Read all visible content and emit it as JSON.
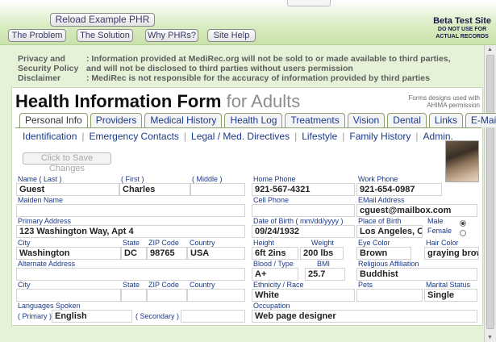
{
  "header": {
    "reload_label": "Reload  Example  PHR",
    "buttons": [
      "The Problem",
      "The Solution",
      "Why PHRs?",
      "Site Help"
    ],
    "beta_title": "Beta Test Site",
    "beta_line1": "DO NOT USE FOR",
    "beta_line2": "ACTUAL RECORDS"
  },
  "notices": [
    {
      "key": "Privacy and",
      "text": ": Information provided at MediRec.org will not be sold to or made available to third parties,"
    },
    {
      "key": "Security Policy",
      "text": "and will not be disclosed to third parties without users permission"
    },
    {
      "key": "Disclaimer",
      "text": ": MediRec is not responsible for the accuracy of information provided by third parties"
    }
  ],
  "form": {
    "title": "Health Information Form",
    "subtitle": "for Adults",
    "note_line1": "Forms designs used with",
    "note_line2": "AHIMA permission",
    "tabs": [
      "Personal Info",
      "Providers",
      "Medical History",
      "Health Log",
      "Treatments",
      "Vision",
      "Dental",
      "Links",
      "E-Mail"
    ],
    "active_tab": "Personal Info",
    "subnav": [
      "Identification",
      "Emergency Contacts",
      "Legal / Med. Directives",
      "Lifestyle",
      "Family History",
      "Admin."
    ],
    "save_label": "Click to Save Changes"
  },
  "labels": {
    "name_last": "Name ( Last )",
    "first": "( First )",
    "middle": "( Middle )",
    "home_phone": "Home Phone",
    "work_phone": "Work Phone",
    "maiden_name": "Maiden Name",
    "cell_phone": "Cell Phone",
    "email": "EMail Address",
    "primary_address": "Primary Address",
    "dob": "Date of Birth  ( mm/dd/yyyy )",
    "place_of_birth": "Place of Birth",
    "male": "Male",
    "female": "Female",
    "city": "City",
    "state": "State",
    "zip": "ZIP Code",
    "country": "Country",
    "height": "Height",
    "weight": "Weight",
    "eye_color": "Eye Color",
    "hair_color": "Hair Color",
    "alternate_address": "Alternate Address",
    "blood_type": "Blood / Type",
    "bmi": "BMI",
    "religious": "Religious Affiliation",
    "ethnicity": "Ethnicity / Race",
    "pets": "Pets",
    "marital": "Marital Status",
    "languages": "Languages Spoken",
    "occupation": "Occupation",
    "primary": "( Primary )",
    "secondary": "( Secondary )"
  },
  "values": {
    "last_name": "Guest",
    "first_name": "Charles",
    "middle_name": "",
    "home_phone": "921-567-4321",
    "work_phone": "921-654-0987",
    "maiden_name": "",
    "cell_phone": "",
    "email": "cguest@mailbox.com",
    "primary_address": "123 Washington Way, Apt 4",
    "dob": "09/24/1932",
    "place_of_birth": "Los Angeles, C",
    "sex": "Male",
    "city": "Washington",
    "state": "DC",
    "zip": "98765",
    "country": "USA",
    "height": "6ft 2ins",
    "weight": "200 lbs",
    "eye_color": "Brown",
    "hair_color": "graying brow",
    "alternate_address": "",
    "blood_type": "A+",
    "bmi": "25.7",
    "religious": "Buddhist",
    "alt_city": "",
    "alt_state": "",
    "alt_zip": "",
    "alt_country": "",
    "ethnicity": "White",
    "pets": "",
    "marital": "Single",
    "language_primary": "English",
    "language_secondary": "",
    "occupation": "Web page designer"
  }
}
